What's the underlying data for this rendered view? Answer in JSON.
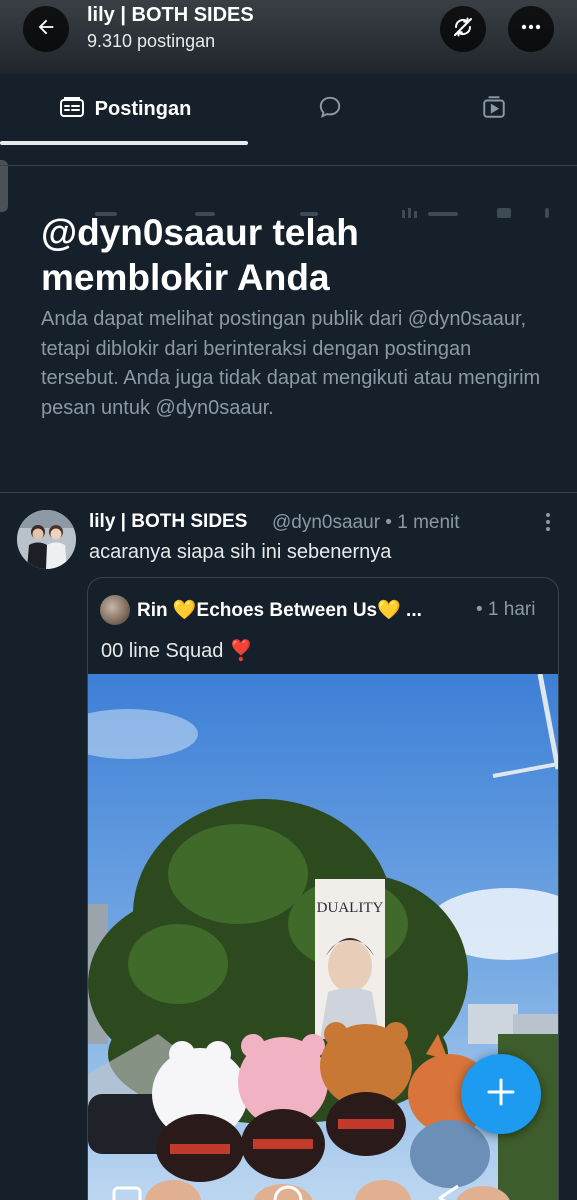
{
  "header": {
    "title": "lily | BOTH SIDES",
    "subtitle": "9.310 postingan",
    "back_icon": "arrow-left-icon",
    "sync_icon": "sync-off-icon",
    "more_icon": "more-horizontal-icon"
  },
  "tabs": [
    {
      "label": "Postingan",
      "icon": "posts-icon",
      "selected": true
    },
    {
      "label": "",
      "icon": "replies-icon",
      "selected": false
    },
    {
      "label": "",
      "icon": "media-icon",
      "selected": false
    }
  ],
  "blocked_notice": {
    "title": "@dyn0saaur telah memblokir Anda",
    "body": "Anda dapat melihat postingan publik dari @dyn0saaur, tetapi diblokir dari berinteraksi dengan postingan tersebut. Anda juga tidak dapat mengikuti atau mengirim pesan untuk @dyn0saaur."
  },
  "post": {
    "display_name": "lily | BOTH SIDES",
    "meta": "@dyn0saaur • 1 menit",
    "text": "acaranya siapa sih ini sebenernya",
    "quote": {
      "display_name": "Rin 💛Echoes Between Us💛 ...",
      "meta": "• 1 hari",
      "text": "00 line Squad ❣️",
      "banner_text": "DUALITY"
    }
  },
  "fab_icon": "plus-icon",
  "colors": {
    "background": "#15202b",
    "accent": "#1d9bf0",
    "secondary_text": "#8b98a5",
    "border": "#38444d"
  }
}
